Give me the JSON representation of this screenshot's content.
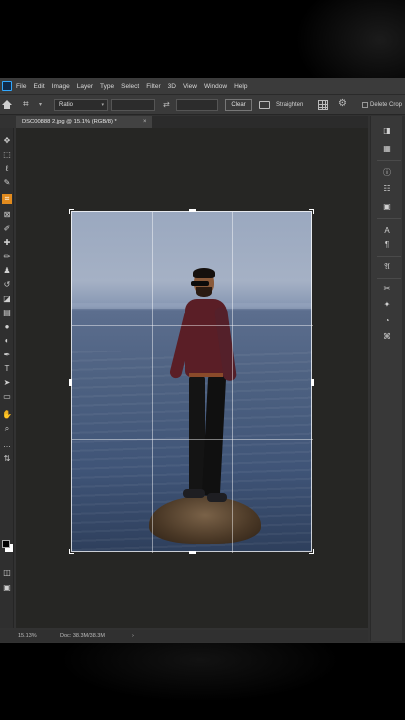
{
  "menubar": {
    "items": [
      "File",
      "Edit",
      "Image",
      "Layer",
      "Type",
      "Select",
      "Filter",
      "3D",
      "View",
      "Window",
      "Help"
    ]
  },
  "options": {
    "ratio_label": "Ratio",
    "clear_label": "Clear",
    "straighten_label": "Straighten",
    "delete_label": "Delete Crop"
  },
  "document": {
    "tab_title": "DSC00888 2.jpg @ 15.1% (RGB/8) *",
    "close_glyph": "×"
  },
  "status": {
    "zoom": "15.13%",
    "doc_info": "Doc: 38.3M/38.3M",
    "arrow": "›"
  },
  "colors": {
    "accent_active_tool": "#e28b1e",
    "ps_blue": "#31a8ff",
    "foreground_color": "#000000",
    "background_color": "#ffffff"
  },
  "tools": [
    "move-icon",
    "marquee-icon",
    "lasso-icon",
    "quick-select-icon",
    "crop-icon",
    "frame-icon",
    "eyedropper-icon",
    "healing-icon",
    "brush-icon",
    "stamp-icon",
    "history-brush-icon",
    "eraser-icon",
    "gradient-icon",
    "blur-icon",
    "dodge-icon",
    "pen-icon",
    "type-icon",
    "path-select-icon",
    "shape-icon",
    "hand-icon",
    "zoom-icon",
    "more-tools-icon"
  ],
  "right_panel_icons": [
    "color-icon",
    "swatches-icon",
    "properties-icon",
    "adjustments-icon",
    "libraries-icon",
    "character-icon",
    "paragraph-icon",
    "glyphs-icon",
    "tools-icon",
    "styles-icon",
    "channels-icon",
    "paths-icon"
  ]
}
